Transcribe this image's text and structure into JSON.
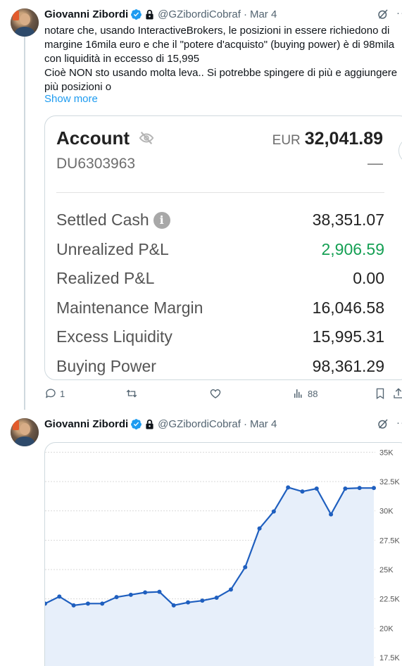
{
  "tweets": [
    {
      "author": "Giovanni Zibordi",
      "handle": "@GZibordiCobraf",
      "date": "Mar 4",
      "text": "notare che, usando InteractiveBrokers, le posizioni in essere richiedono di margine 16mila euro e che il \"potere d'acquisto\" (buying power) è di 98mila con liquidità in eccesso di 15,995\nCioè NON sto usando molta leva.. Si potrebbe spingere di più e aggiungere più posizioni o",
      "show_more": "Show more",
      "account": {
        "title": "Account",
        "id": "DU6303963",
        "currency": "EUR",
        "total": "32,041.89",
        "change": "—",
        "rows": [
          {
            "label": "Settled Cash",
            "value": "38,351.07"
          },
          {
            "label": "Unrealized P&L",
            "value": "2,906.59"
          },
          {
            "label": "Realized P&L",
            "value": "0.00"
          },
          {
            "label": "Maintenance Margin",
            "value": "16,046.58"
          },
          {
            "label": "Excess Liquidity",
            "value": "15,995.31"
          },
          {
            "label": "Buying Power",
            "value": "98,361.29"
          }
        ],
        "colors": {
          "positive": "#15a054"
        }
      },
      "actions": {
        "replies": "1",
        "retweets": "",
        "likes": "",
        "views": "88"
      }
    },
    {
      "author": "Giovanni Zibordi",
      "handle": "@GZibordiCobraf",
      "date": "Mar 4"
    }
  ],
  "chart_data": {
    "type": "area",
    "title": "",
    "xlabel": "",
    "ylabel": "",
    "y_tick_labels": [
      "35K",
      "32.5K",
      "30K",
      "27.5K",
      "25K",
      "22.5K",
      "20K",
      "17.5K"
    ],
    "y_ticks": [
      35000,
      32500,
      30000,
      27500,
      25000,
      22500,
      20000,
      17500
    ],
    "ylim": [
      16300,
      35500
    ],
    "grid": true,
    "x": [
      0,
      1,
      2,
      3,
      4,
      5,
      6,
      7,
      8,
      9,
      10,
      11,
      12,
      13,
      14,
      15,
      16,
      17,
      18,
      19,
      20,
      21,
      22,
      23
    ],
    "values": [
      22100,
      22700,
      21950,
      22100,
      22100,
      22650,
      22850,
      23050,
      23100,
      21950,
      22200,
      22350,
      22600,
      23300,
      25200,
      28500,
      29950,
      32000,
      31650,
      31900,
      29700,
      31900,
      31950,
      31950
    ],
    "colors": {
      "line": "#1f5fbf",
      "fill": "#e7effa",
      "grid": "#d9d9d9"
    }
  }
}
